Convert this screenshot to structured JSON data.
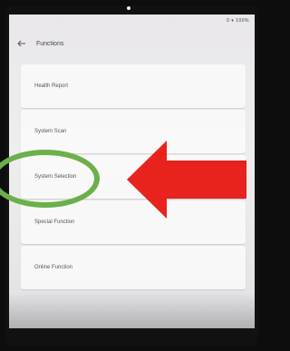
{
  "header": {
    "title": "Functions"
  },
  "status_bar": {
    "text": "0 ▾ 100%"
  },
  "menu": [
    {
      "label": "Health Report"
    },
    {
      "label": "System Scan"
    },
    {
      "label": "System Selection"
    },
    {
      "label": "Special Function"
    },
    {
      "label": "Online Function"
    }
  ],
  "annotations": {
    "highlight_color": "#6bb04a",
    "arrow_color": "#e8221c"
  },
  "icons": {
    "back": "arrow-left-icon"
  }
}
